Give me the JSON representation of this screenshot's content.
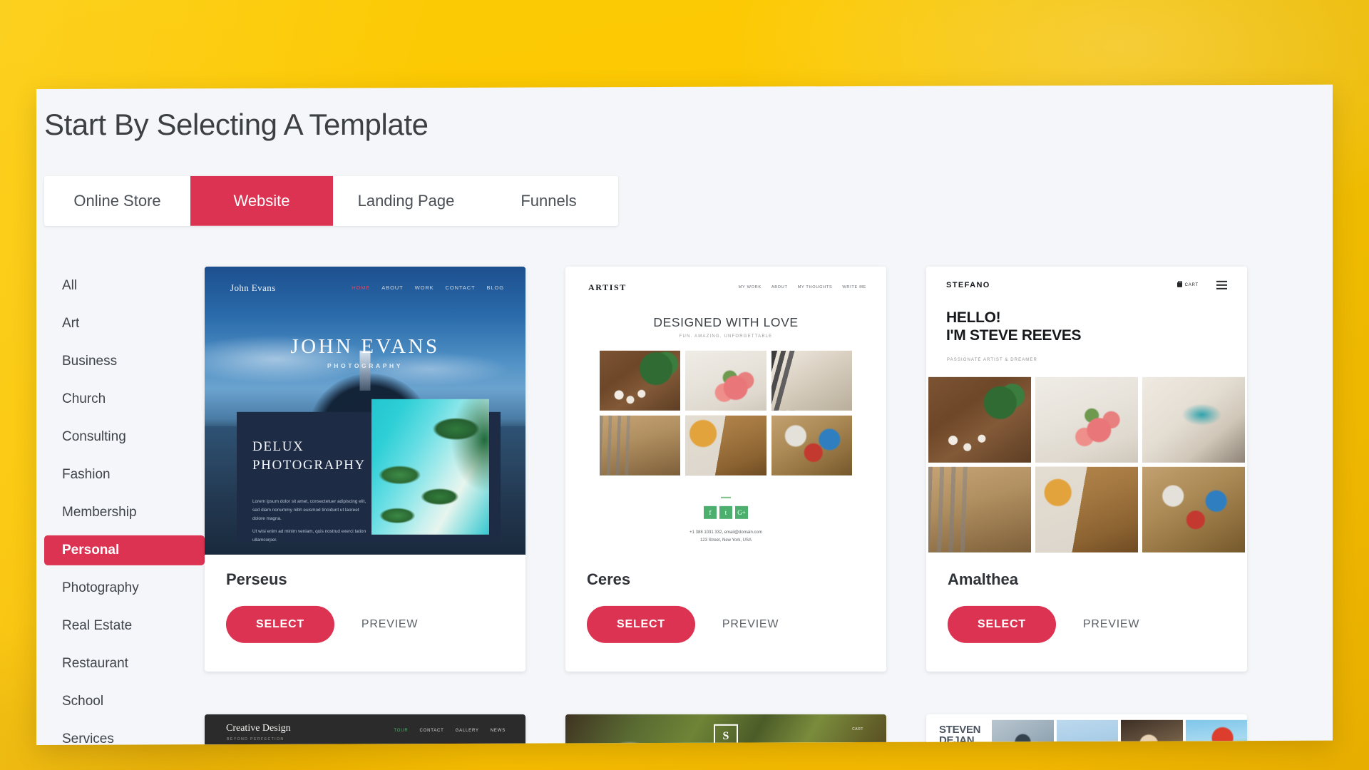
{
  "page": {
    "title": "Start By Selecting A Template",
    "accent_color": "#dd3352",
    "background_color": "#fbc800",
    "panel_color": "#f4f6f9"
  },
  "tabs": [
    {
      "label": "Online Store",
      "active": false
    },
    {
      "label": "Website",
      "active": true
    },
    {
      "label": "Landing Page",
      "active": false
    },
    {
      "label": "Funnels",
      "active": false
    }
  ],
  "sidebar": {
    "categories": [
      {
        "label": "All",
        "active": false
      },
      {
        "label": "Art",
        "active": false
      },
      {
        "label": "Business",
        "active": false
      },
      {
        "label": "Church",
        "active": false
      },
      {
        "label": "Consulting",
        "active": false
      },
      {
        "label": "Fashion",
        "active": false
      },
      {
        "label": "Membership",
        "active": false
      },
      {
        "label": "Personal",
        "active": true
      },
      {
        "label": "Photography",
        "active": false
      },
      {
        "label": "Real Estate",
        "active": false
      },
      {
        "label": "Restaurant",
        "active": false
      },
      {
        "label": "School",
        "active": false
      },
      {
        "label": "Services",
        "active": false
      }
    ]
  },
  "actions": {
    "select_label": "SELECT",
    "preview_label": "PREVIEW"
  },
  "templates": [
    {
      "name": "Perseus",
      "preview": {
        "logo": "John Evans",
        "nav": [
          "HOME",
          "ABOUT",
          "WORK",
          "CONTACT",
          "BLOG"
        ],
        "hero_title": "JOHN EVANS",
        "hero_subtitle": "PHOTOGRAPHY",
        "panel_heading_line1": "DELUX",
        "panel_heading_line2": "PHOTOGRAPHY",
        "panel_body1": "Lorem ipsum dolor sit amet, consectetuer adipiscing elit, sed diam nonummy nibh euismod tincidunt ut laoreet dolore magna.",
        "panel_body2": "Ut wisi enim ad minim veniam, quis nostrud exerci tation ullamcorper."
      }
    },
    {
      "name": "Ceres",
      "preview": {
        "logo": "ARTIST",
        "nav": [
          "MY WORK",
          "ABOUT",
          "MY THOUGHTS",
          "WRITE ME"
        ],
        "hero_title": "DESIGNED WITH LOVE",
        "hero_subtitle": "FUN. AMAZING. UNFORGETTABLE",
        "social": [
          "f",
          "t",
          "G+"
        ],
        "contact_line1": "+1 388 1031 332, email@domain.com",
        "contact_line2": "123 Street, New York, USA"
      }
    },
    {
      "name": "Amalthea",
      "preview": {
        "logo": "STEFANO",
        "cart_label": "CART",
        "hero_title_line1": "HELLO!",
        "hero_title_line2": "I'M STEVE REEVES",
        "hero_subtitle": "PASSIONATE ARTIST & DREAMER"
      }
    }
  ],
  "templates_partial": [
    {
      "preview": {
        "logo": "Creative Design",
        "tagline": "BEYOND PERFECTION",
        "nav": [
          "TOUR",
          "CONTACT",
          "GALLERY",
          "NEWS"
        ]
      }
    },
    {
      "preview": {
        "logo": "S",
        "cart_label": "CART"
      }
    },
    {
      "preview": {
        "name_line1": "STEVEN",
        "name_line2": "DEJAN"
      }
    }
  ]
}
